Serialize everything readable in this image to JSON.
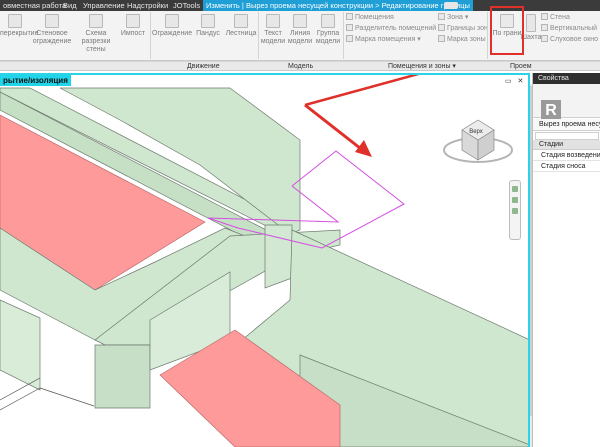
{
  "tabs": [
    {
      "label": "овместная работа"
    },
    {
      "label": "Вид"
    },
    {
      "label": "Управление"
    },
    {
      "label": "Надстройки"
    },
    {
      "label": "JOTools"
    },
    {
      "label": "Изменить | Вырез проема несущей конструкции > Редактирование границы",
      "active": true
    }
  ],
  "ribbon": {
    "buttons": [
      {
        "label": "перекрытие"
      },
      {
        "label": "Стеновое ограждение"
      },
      {
        "label": "Схема разрезки стены"
      },
      {
        "label": "Импост"
      },
      {
        "label": "Ограждение"
      },
      {
        "label": "Пандус"
      },
      {
        "label": "Лестница"
      },
      {
        "label": "Текст модели"
      },
      {
        "label": "Линия модели"
      },
      {
        "label": "Группа модели"
      },
      {
        "label": "По грани"
      },
      {
        "label": "Шахта"
      }
    ],
    "list_rooms": [
      "Помещения",
      "Разделитель помещений",
      "Марка помещения ▾"
    ],
    "list_zones": [
      "Зона ▾",
      "Границы зон",
      "Марка зоны"
    ],
    "list_opening": [
      "Стена",
      "Вертикальный",
      "Слуховое окно"
    ],
    "panels": {
      "movement": "Движение",
      "model": "Модель",
      "rooms_zones": "Помещения и зоны ▾",
      "opening": "Проем"
    }
  },
  "view": {
    "title": "рытие/изоляция",
    "window_controls": "▭ ✕"
  },
  "viewcube": {
    "face": "Верх"
  },
  "properties": {
    "title": "Свойства",
    "close": "✕",
    "logo": "R",
    "type_name": "Вырез проема несущ",
    "group": "Стадии",
    "rows": [
      "Стадия возведения",
      "Стадия сноса"
    ]
  },
  "colors": {
    "highlight": "#e0302a",
    "green_fill": "#cfe6cf",
    "pink_fill": "#ff9a9a",
    "sketch_line": "#d44ee0",
    "view_accent": "#20d4ea"
  }
}
